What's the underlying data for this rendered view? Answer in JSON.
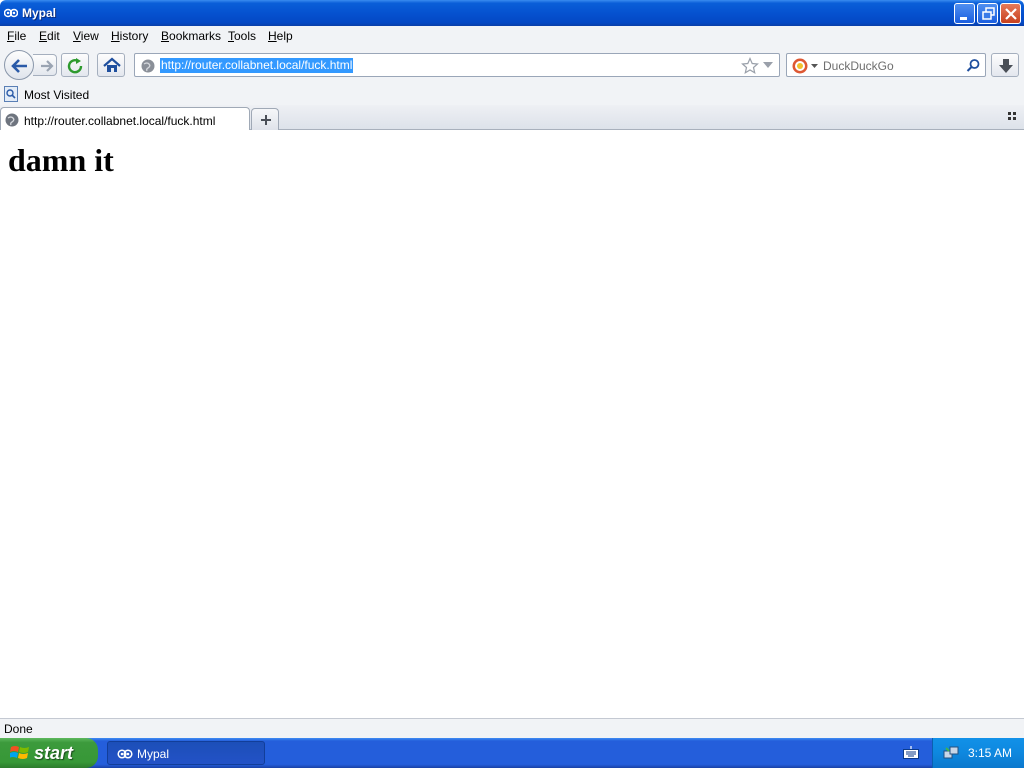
{
  "window": {
    "title": "Mypal"
  },
  "menubar": {
    "items": [
      "File",
      "Edit",
      "View",
      "History",
      "Bookmarks",
      "Tools",
      "Help"
    ]
  },
  "toolbar": {
    "url": "http://router.collabnet.local/fuck.html",
    "search_placeholder": "DuckDuckGo"
  },
  "bookmarks": {
    "most_visited": "Most Visited"
  },
  "tabs": [
    {
      "label": "http://router.collabnet.local/fuck.html"
    }
  ],
  "page": {
    "heading": "damn it"
  },
  "status": {
    "text": "Done"
  },
  "taskbar": {
    "start_label": "start",
    "task_label": "Mypal",
    "clock": "3:15 AM"
  }
}
